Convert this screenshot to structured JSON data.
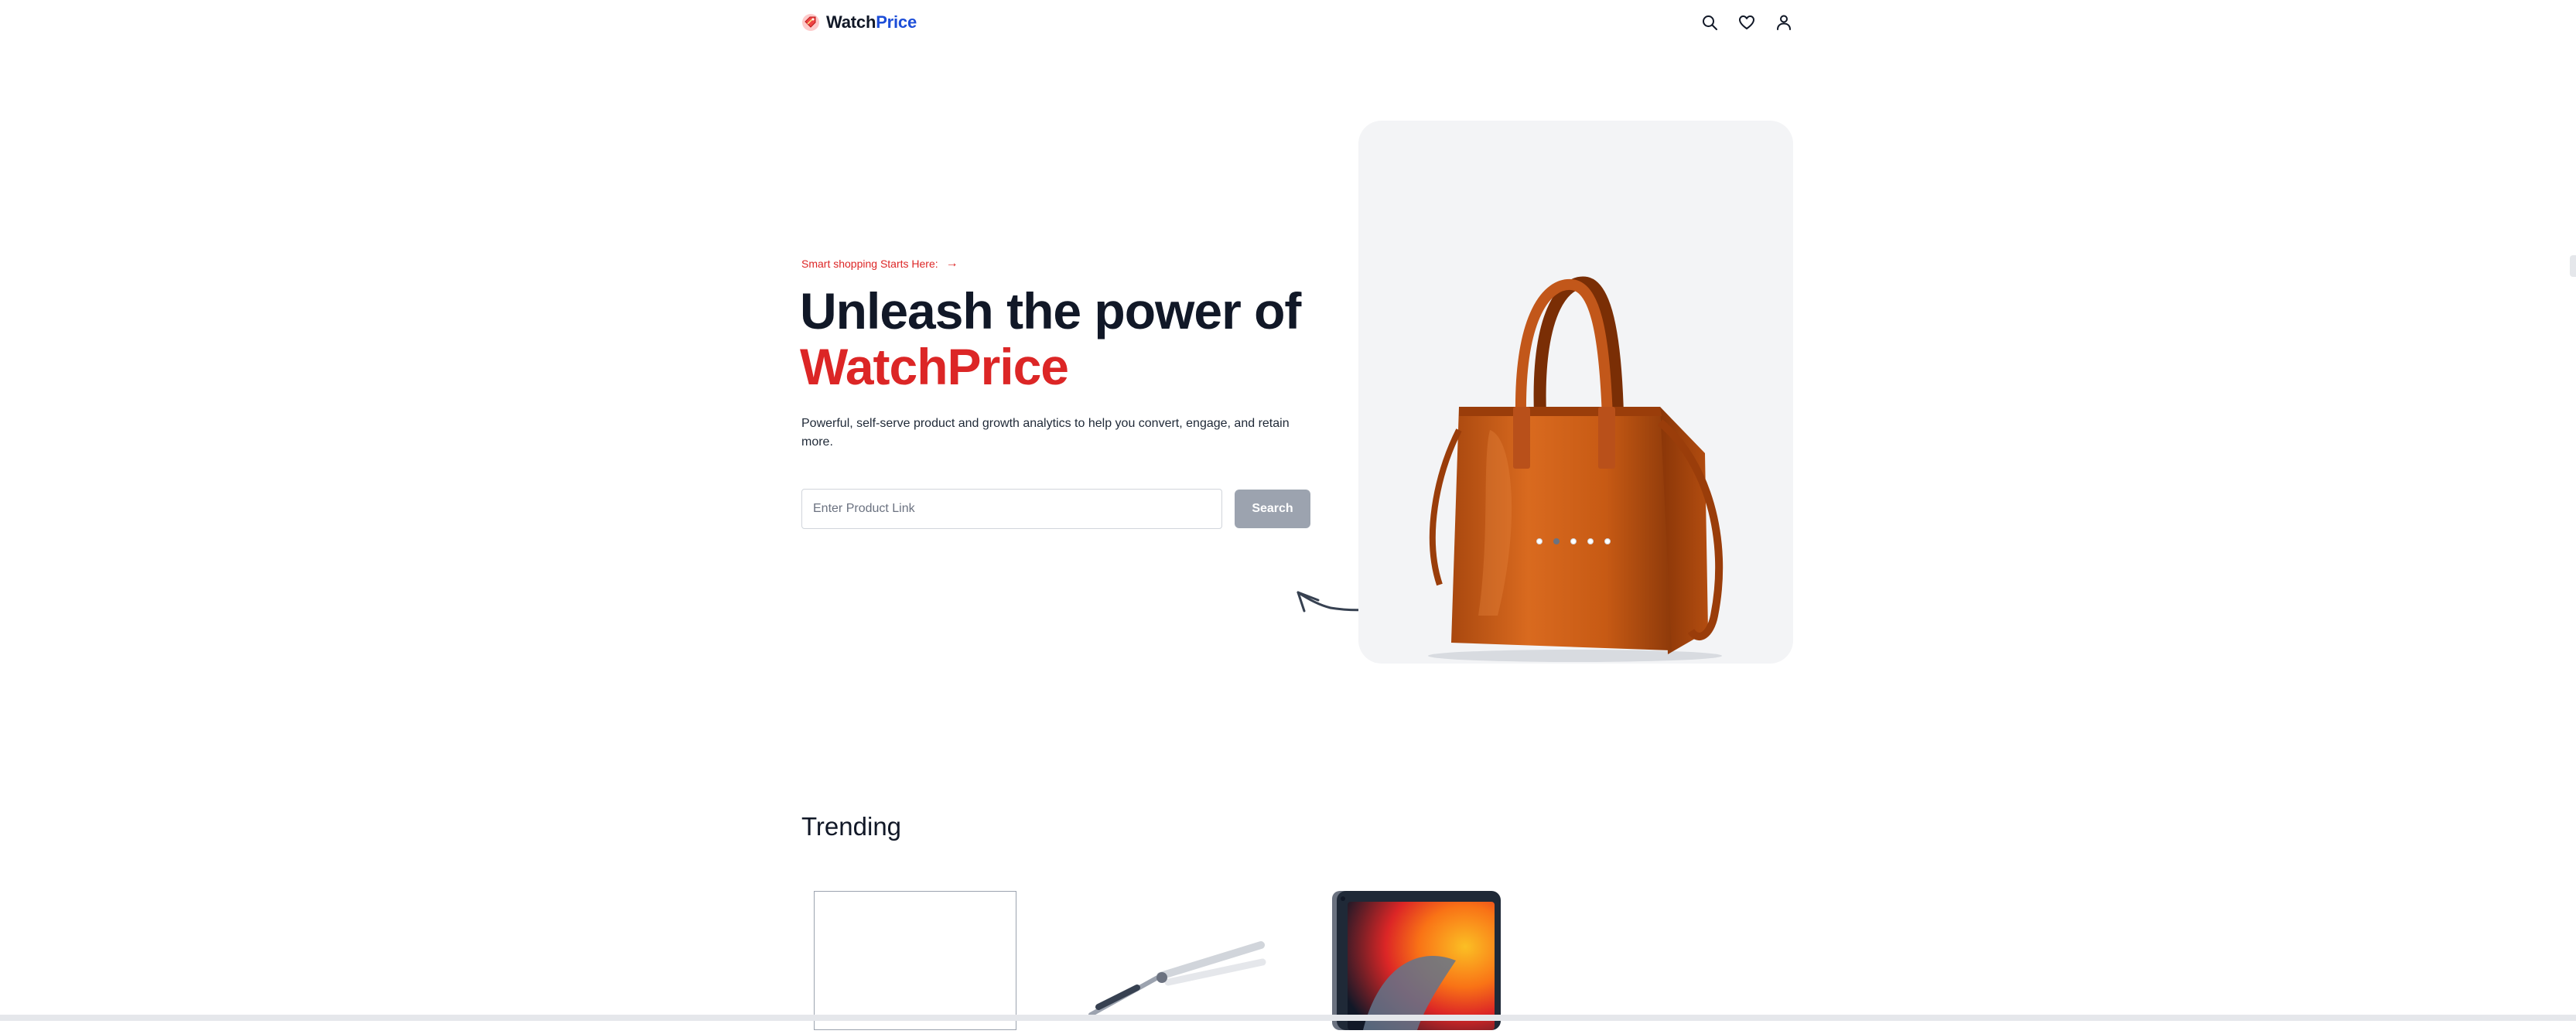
{
  "brand": {
    "name_part1": "Watch",
    "name_part2": "Price",
    "logo_icon": "price-tag-icon",
    "colors": {
      "primary_text": "#111827",
      "secondary_text": "#1d4ed8",
      "accent": "#dc2626"
    }
  },
  "header": {
    "icons": [
      "search-icon",
      "heart-icon",
      "user-icon"
    ]
  },
  "hero": {
    "tagline": "Smart shopping Starts Here:",
    "tagline_arrow": "→",
    "title_line1": "Unleash the power of",
    "title_line2": "WatchPrice",
    "description": "Powerful, self-serve product and growth analytics to help you convert, engage, and retain more.",
    "input_placeholder": "Enter Product Link",
    "input_value": "",
    "search_label": "Search",
    "carousel": {
      "image": "orange-leather-handbag",
      "slide_count": 5,
      "active_slide": 2
    }
  },
  "trending": {
    "title": "Trending",
    "items": [
      {
        "image": "blank-product-placeholder"
      },
      {
        "image": "metal-pliers-tool"
      },
      {
        "image": "ipad-tablet"
      }
    ]
  }
}
